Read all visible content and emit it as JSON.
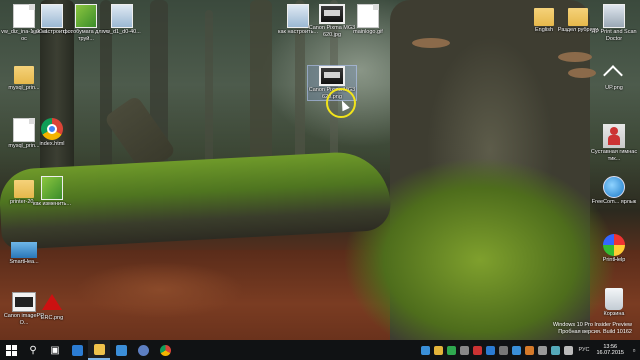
{
  "desktop": {
    "icons": [
      {
        "label": "vw_diz_ina-1_00.doc"
      },
      {
        "label": "как настроить..."
      },
      {
        "label": "фотобумага для струй..."
      },
      {
        "label": "vw_d1_d0-40..."
      },
      {
        "label": "как настроить..."
      },
      {
        "label": "Canon Pixma MG3620.jpg"
      },
      {
        "label": "mainlogo.gif"
      },
      {
        "label": "English"
      },
      {
        "label": "Раздел рубрики"
      },
      {
        "label": "HP Print and Scan Doctor"
      },
      {
        "label": "mysql_prin..."
      },
      {
        "label": "Canon Pixma MG3620.png"
      },
      {
        "label": "UP.png"
      },
      {
        "label": "mysql_prin..."
      },
      {
        "label": "index.html"
      },
      {
        "label": "Суставная гимнастик..."
      },
      {
        "label": "printer-20..."
      },
      {
        "label": "как изменить..."
      },
      {
        "label": "FreeCom... ярлык"
      },
      {
        "label": "SmartHea..."
      },
      {
        "label": "PrintHelp"
      },
      {
        "label": "Canon imagePRO..."
      },
      {
        "label": "ERC.png"
      },
      {
        "label": "Корзина"
      }
    ],
    "watermark_line1": "Windows 10 Pro Insider Preview",
    "watermark_line2": "Пробная версия. Build 10162"
  },
  "taskbar": {
    "search_icon": "search-icon",
    "task_view_icon": "task-view-icon",
    "tray_lang": "РУС",
    "clock_time": "13:56",
    "clock_date": "16.07.2015"
  },
  "colors": {
    "taskbar_bg": "#101214",
    "cursor_ring": "#f2e41a",
    "active_indicator": "#7fb4e6"
  }
}
